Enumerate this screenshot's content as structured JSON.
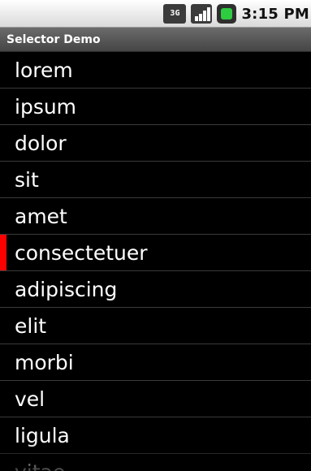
{
  "status_bar": {
    "time": "3:15 PM",
    "network_label": "3G",
    "icons": [
      "3g-icon",
      "signal-icon",
      "battery-icon"
    ]
  },
  "app": {
    "title": "Selector Demo"
  },
  "list": {
    "selected_label": "consectetuer",
    "selector_color": "#ff0000",
    "items": [
      {
        "label": "lorem"
      },
      {
        "label": "ipsum"
      },
      {
        "label": "dolor"
      },
      {
        "label": "sit"
      },
      {
        "label": "amet"
      },
      {
        "label": "consectetuer"
      },
      {
        "label": "adipiscing"
      },
      {
        "label": "elit"
      },
      {
        "label": "morbi"
      },
      {
        "label": "vel"
      },
      {
        "label": "ligula"
      },
      {
        "label": "vitae"
      }
    ]
  }
}
